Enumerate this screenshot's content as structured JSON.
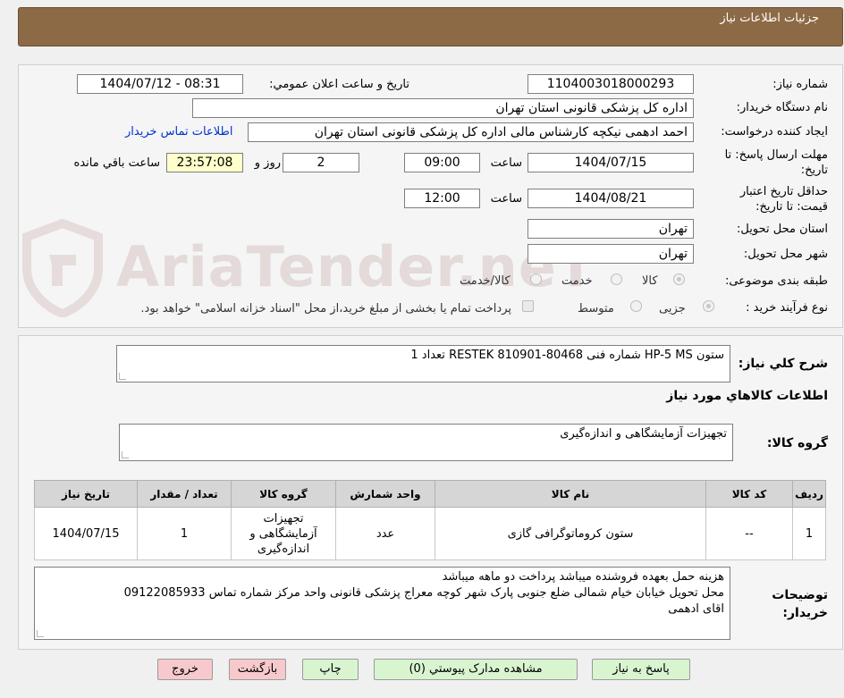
{
  "header": {
    "title": "جزئیات اطلاعات نیاز"
  },
  "watermark": {
    "text": "AriaTender.neT"
  },
  "form": {
    "need_number_label": "شماره نیاز:",
    "need_number": "1104003018000293",
    "announce_label": "تاریخ و ساعت اعلان عمومي:",
    "announce_value": "1404/07/12 - 08:31",
    "buyer_org_label": "نام دستگاه خریدار:",
    "buyer_org": "اداره کل پزشکی قانونی استان تهران",
    "requester_label": "ایجاد کننده درخواست:",
    "requester": "احمد ادهمی نیکچه کارشناس مالی اداره کل پزشکی قانونی استان تهران",
    "contact_link": "اطلاعات تماس خریدار",
    "deadline_label": "مهلت ارسال پاسخ: تا تاریخ:",
    "deadline_date": "1404/07/15",
    "time_label": "ساعت",
    "deadline_time": "09:00",
    "days_value": "2",
    "days_label": "روز و",
    "remaining_time": "23:57:08",
    "remaining_label": "ساعت باقي مانده",
    "validity_label": "حداقل تاریخ اعتبار قیمت: تا تاریخ:",
    "validity_date": "1404/08/21",
    "validity_time_label": "ساعت",
    "validity_time": "12:00",
    "province_label": "استان محل تحویل:",
    "province": "تهران",
    "city_label": "شهر محل تحویل:",
    "city": "تهران",
    "category_label": "طبقه بندی موضوعی:",
    "category_options": [
      "کالا",
      "خدمت",
      "کالا/خدمت"
    ],
    "purchase_type_label": "نوع فرآیند خرید :",
    "purchase_options": [
      "جزیی",
      "متوسط"
    ],
    "payment_note": "پرداخت تمام یا بخشی از مبلغ خرید،از محل \"اسناد خزانه اسلامی\" خواهد بود."
  },
  "summary": {
    "label": "شرح کلي نیاز:",
    "text": "ستون HP-5 MS شماره فنی RESTEK 810901-80468 تعداد 1"
  },
  "goods": {
    "section_title": "اطلاعات کالاهاي مورد نیاز",
    "group_label": "گروه کالا:",
    "group_value": "تجهیزات آزمایشگاهی و اندازه‌گیری"
  },
  "table": {
    "headers": [
      "ردیف",
      "کد کالا",
      "نام کالا",
      "واحد شمارش",
      "گروه کالا",
      "تعداد / مقدار",
      "تاریخ نیاز"
    ],
    "rows": [
      {
        "row": "1",
        "code": "--",
        "name": "ستون کروماتوگرافی گازی",
        "unit": "عدد",
        "group": "تجهیزات آزمایشگاهی و اندازه‌گیری",
        "qty": "1",
        "date": "1404/07/15"
      }
    ]
  },
  "notes": {
    "label_line1": "توضیحات",
    "label_line2": "خریدار:",
    "line1": "هزینه حمل بعهده فروشنده میباشد پرداخت دو ماهه میباشد",
    "line2": "محل تحویل خیابان خیام شمالی ضلع جنوبی پارک شهر کوچه معراج پزشکی قانونی واحد مرکز شماره تماس 09122085933",
    "line3": "اقای ادهمی"
  },
  "buttons": {
    "reply": "پاسخ به نیاز",
    "attachments": "مشاهده مدارک پیوستي (0)",
    "print": "چاپ",
    "back": "بازگشت",
    "exit": "خروج"
  }
}
